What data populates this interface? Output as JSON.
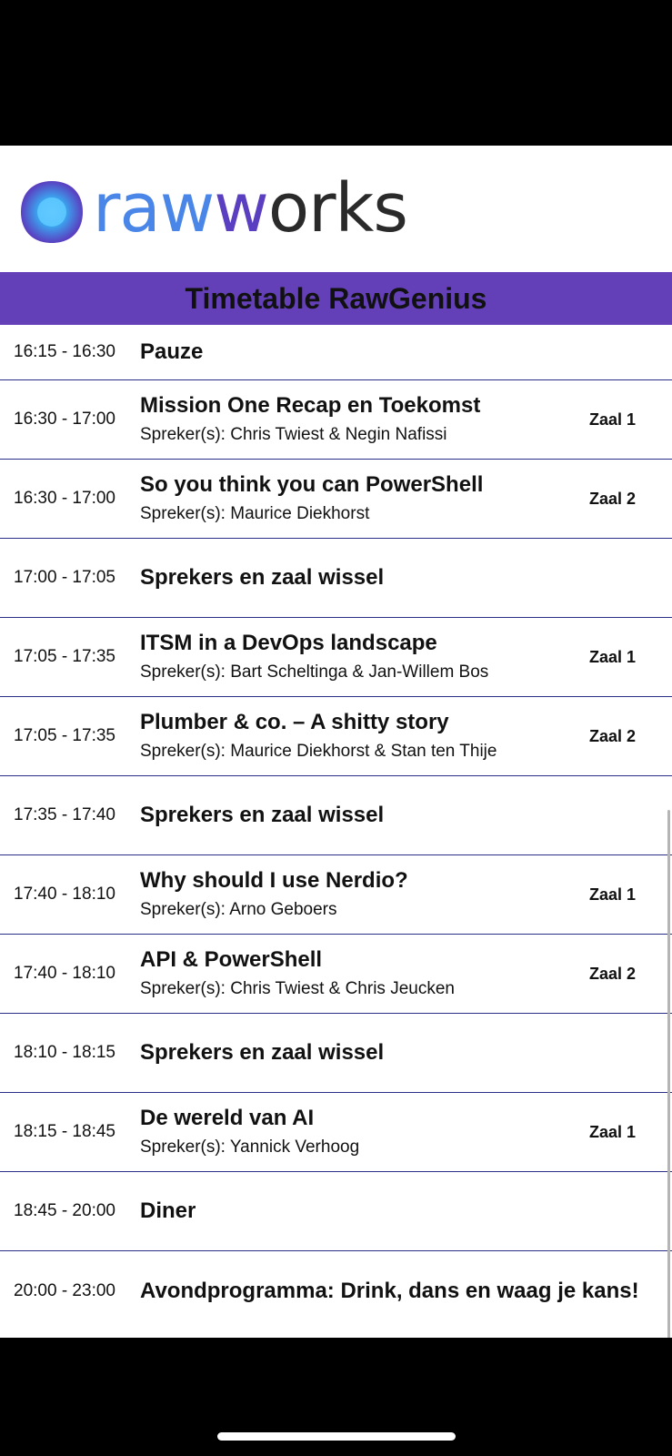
{
  "header": {
    "logo_text_part1": "raw",
    "logo_text_part2": "w",
    "logo_text_part3": "orks",
    "title": "Timetable RawGenius"
  },
  "colors": {
    "title_bar": "#6440b8",
    "row_divider": "#2a2e86",
    "logo_blue": "#4a86e8",
    "logo_purple": "#5a3fc0"
  },
  "rows": [
    {
      "time": "16:15 - 16:30",
      "title": "Pauze",
      "speaker": "",
      "room": ""
    },
    {
      "time": "16:30 - 17:00",
      "title": "Mission One Recap en Toekomst",
      "speaker": "Spreker(s): Chris Twiest & Negin Nafissi",
      "room": "Zaal 1"
    },
    {
      "time": "16:30 - 17:00",
      "title": "So you think you can PowerShell",
      "speaker": "Spreker(s): Maurice Diekhorst",
      "room": "Zaal 2"
    },
    {
      "time": "17:00 - 17:05",
      "title": "Sprekers en zaal wissel",
      "speaker": "",
      "room": ""
    },
    {
      "time": "17:05 - 17:35",
      "title": "ITSM in a DevOps landscape",
      "speaker": "Spreker(s): Bart Scheltinga & Jan-Willem Bos",
      "room": "Zaal 1"
    },
    {
      "time": "17:05 - 17:35",
      "title": "Plumber & co. – A shitty story",
      "speaker": "Spreker(s): Maurice Diekhorst & Stan ten Thije",
      "room": "Zaal 2"
    },
    {
      "time": "17:35 - 17:40",
      "title": "Sprekers en zaal wissel",
      "speaker": "",
      "room": ""
    },
    {
      "time": "17:40 - 18:10",
      "title": "Why should I use Nerdio?",
      "speaker": "Spreker(s): Arno Geboers",
      "room": "Zaal 1"
    },
    {
      "time": "17:40 - 18:10",
      "title": "API & PowerShell",
      "speaker": "Spreker(s): Chris Twiest & Chris Jeucken",
      "room": "Zaal 2"
    },
    {
      "time": "18:10 - 18:15",
      "title": "Sprekers en zaal wissel",
      "speaker": "",
      "room": ""
    },
    {
      "time": "18:15 - 18:45",
      "title": "De wereld van AI",
      "speaker": "Spreker(s): Yannick Verhoog",
      "room": "Zaal 1"
    },
    {
      "time": "18:45 - 20:00",
      "title": "Diner",
      "speaker": "",
      "room": ""
    },
    {
      "time": "20:00 - 23:00",
      "title": "Avondprogramma: Drink, dans en waag je kans!",
      "speaker": "",
      "room": ""
    }
  ]
}
